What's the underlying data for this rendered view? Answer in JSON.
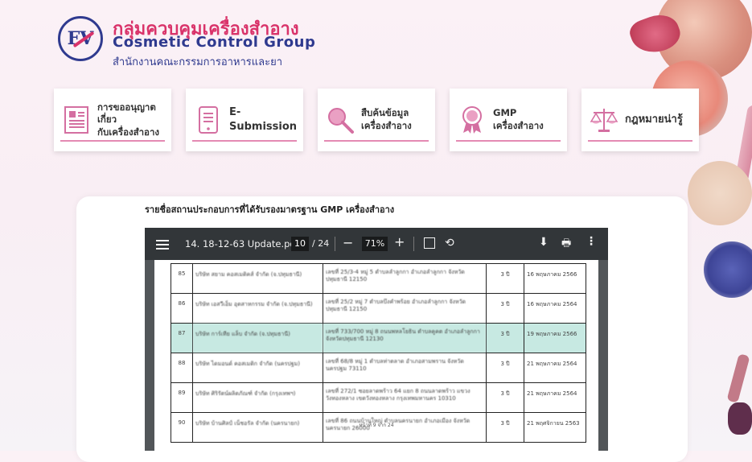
{
  "header": {
    "logo_mark": "FV",
    "title_th": "กลุ่มควบคุมเครื่องสำอาง",
    "title_en": "Cosmetic Control Group",
    "subtitle": "สำนักงานคณะกรรมการอาหารและยา"
  },
  "menu": [
    {
      "label": "การขออนุญาตเกี่ยว\nกับเครื่องสำอาง",
      "icon": "document-icon"
    },
    {
      "label": "E-Submission",
      "icon": "tablet-icon"
    },
    {
      "label": "สืบค้นข้อมูล\nเครื่องสำอาง",
      "icon": "magnifier-icon"
    },
    {
      "label": "GMP\nเครื่องสำอาง",
      "icon": "award-badge-icon"
    },
    {
      "label": "กฎหมายน่ารู้",
      "icon": "scales-icon"
    }
  ],
  "content": {
    "title": "รายชื่อสถานประกอบการที่ได้รับรองมาตรฐาน GMP เครื่องสำอาง"
  },
  "pdf": {
    "filename": "14. 18-12-63 Update.pdf",
    "page_current": "10",
    "page_total": "/ 24",
    "zoom": "71%",
    "footer": "หน้าที่ 9 จาก 24",
    "rows": [
      {
        "no": "85",
        "company": "บริษัท สยาม คอสเมติคส์ จำกัด (จ.ปทุมธานี)",
        "address": "เลขที่ 25/3-4 หมู่ 5 ตำบลลำลูกกา อำเภอลำลูกกา จังหวัดปทุมธานี 12150",
        "years": "3 ปี",
        "date": "16 พฤษภาคม 2566"
      },
      {
        "no": "86",
        "company": "บริษัท เอสวีเอ็ม อุตสาหกรรม จำกัด (จ.ปทุมธานี)",
        "address": "เลขที่ 25/2 หมู่ 7 ตำบลบึงคำพร้อย อำเภอลำลูกกา จังหวัดปทุมธานี 12150",
        "years": "3 ปี",
        "date": "16 พฤษภาคม 2564"
      },
      {
        "no": "87",
        "company": "บริษัท การ์เทีย แล็บ จำกัด (จ.ปทุมธานี)",
        "address": "เลขที่ 733/700 หมู่ 8 ถนนพหลโยธิน ตำบลคูคต อำเภอลำลูกกา จังหวัดปทุมธานี 12130",
        "years": "3 ปี",
        "date": "19 พฤษภาคม 2566"
      },
      {
        "no": "88",
        "company": "บริษัท ไดมอนด์ คอสเมติก จำกัด (นครปฐม)",
        "address": "เลขที่ 68/8 หมู่ 1 ตำบลท่าตลาด อำเภอสามพราน จังหวัดนครปฐม 73110",
        "years": "3 ปี",
        "date": "21 พฤษภาคม 2564"
      },
      {
        "no": "89",
        "company": "บริษัท ศิริรัตน์ผลิตภัณฑ์ จำกัด (กรุงเทพฯ)",
        "address": "เลขที่ 272/1 ซอยลาดพร้าว 64 แยก 8 ถนนลาดพร้าว แขวงวังทองหลาง เขตวังทองหลาง กรุงเทพมหานคร 10310",
        "years": "3 ปี",
        "date": "21 พฤษภาคม 2564"
      },
      {
        "no": "90",
        "company": "บริษัท บ้านศิลป์ เน็ชอรัล จำกัด (นครนายก)",
        "address": "เลขที่ 86 ถนนบ้านใหญ่ ตำบลนครนายก อำเภอเมือง จังหวัดนครนายก 26000",
        "years": "3 ปี",
        "date": "21 พฤศจิกายน 2563"
      }
    ]
  }
}
